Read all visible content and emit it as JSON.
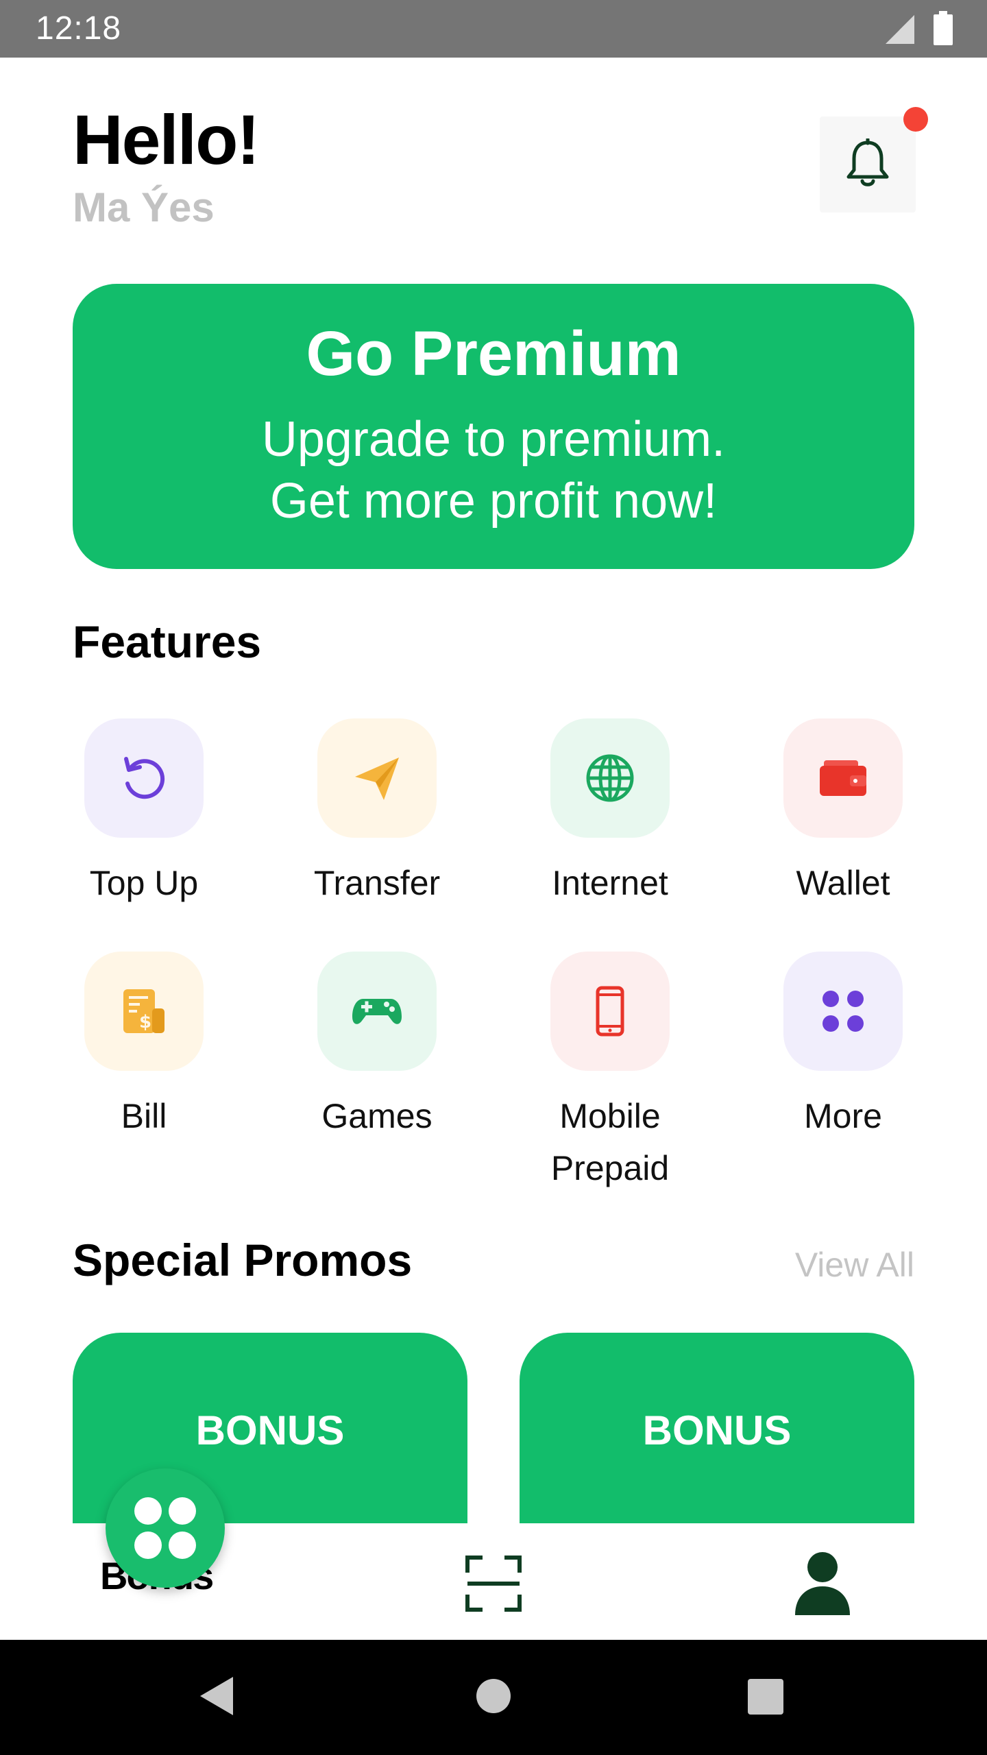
{
  "status_bar": {
    "time": "12:18"
  },
  "header": {
    "greeting": "Hello!",
    "user_name": "Ma Ýes"
  },
  "premium_banner": {
    "title": "Go Premium",
    "line1": "Upgrade to premium.",
    "line2": "Get more profit now!"
  },
  "features": {
    "title": "Features",
    "items": [
      {
        "label": "Top Up",
        "icon": "refresh-icon"
      },
      {
        "label": "Transfer",
        "icon": "send-icon"
      },
      {
        "label": "Internet",
        "icon": "globe-icon"
      },
      {
        "label": "Wallet",
        "icon": "wallet-icon"
      },
      {
        "label": "Bill",
        "icon": "bill-icon"
      },
      {
        "label": "Games",
        "icon": "gamepad-icon"
      },
      {
        "label": "Mobile Prepaid",
        "label_line1": "Mobile",
        "label_line2": "Prepaid",
        "icon": "phone-icon"
      },
      {
        "label": "More",
        "icon": "grid-icon"
      }
    ]
  },
  "promos": {
    "title": "Special Promos",
    "view_all": "View All",
    "cards": [
      {
        "label": "BONUS"
      },
      {
        "label": "BONUS"
      }
    ]
  },
  "bottom_nav": {
    "hidden_label": "Bonus"
  },
  "colors": {
    "primary": "#12bd6b",
    "purple": "#6c3fd9",
    "orange": "#f5b43c",
    "green_icon": "#1ba85f",
    "red": "#f44336",
    "dark_green": "#0f3d22"
  }
}
